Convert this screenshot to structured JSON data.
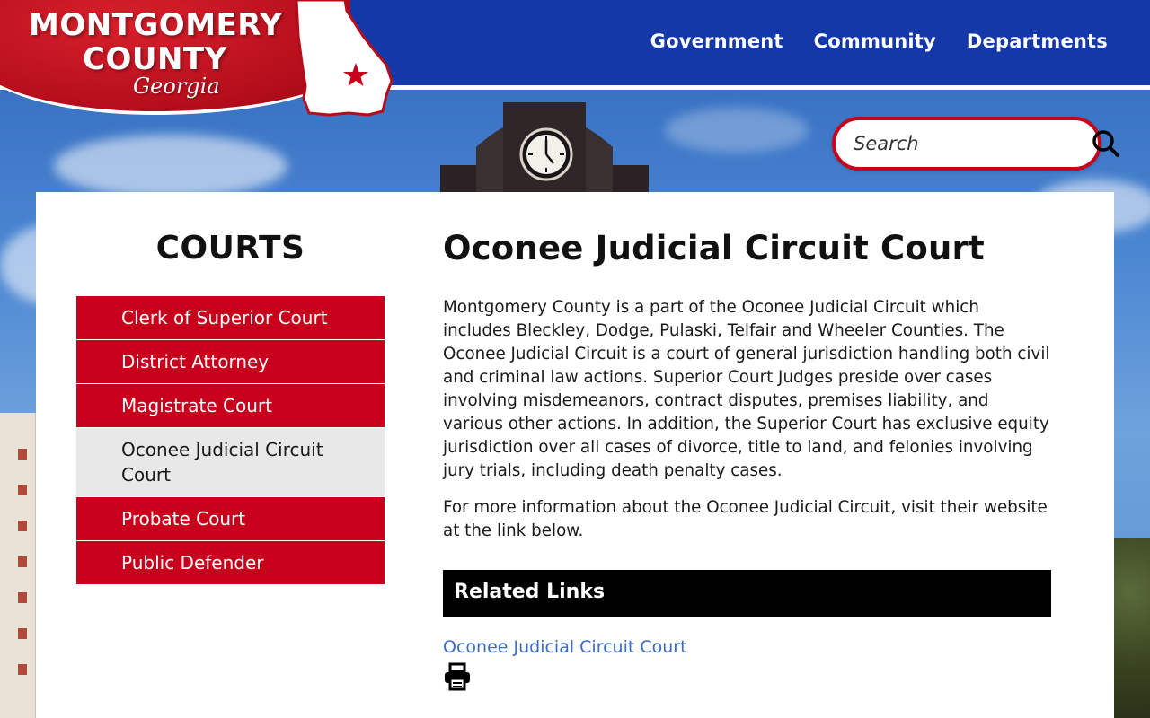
{
  "header": {
    "logo": {
      "line1": "MONTGOMERY",
      "line2": "COUNTY",
      "line3": "Georgia"
    },
    "nav": [
      {
        "label": "Government"
      },
      {
        "label": "Community"
      },
      {
        "label": "Departments"
      }
    ],
    "search": {
      "placeholder": "Search",
      "icon": "search-icon"
    }
  },
  "sidebar": {
    "title": "COURTS",
    "items": [
      {
        "label": "Clerk of Superior Court",
        "active": false
      },
      {
        "label": "District Attorney",
        "active": false
      },
      {
        "label": "Magistrate Court",
        "active": false
      },
      {
        "label": "Oconee Judicial Circuit Court",
        "active": true
      },
      {
        "label": "Probate Court",
        "active": false
      },
      {
        "label": "Public Defender",
        "active": false
      }
    ]
  },
  "main": {
    "title": "Oconee Judicial Circuit Court",
    "paragraph1": "Montgomery County is a part of the Oconee Judicial Circuit which includes Bleckley, Dodge, Pulaski, Telfair and Wheeler Counties. The Oconee Judicial Circuit is a court of general jurisdiction handling both civil and criminal law actions. Superior Court Judges preside over cases involving misdemeanors, contract disputes, premises liability, and various other actions. In addition, the Superior Court has exclusive equity jurisdiction over all cases of divorce, title to land, and felonies involving jury trials, including death penalty cases.",
    "paragraph2": "For more information about the Oconee Judicial Circuit, visit their website at the link below.",
    "related_heading": "Related Links",
    "related_links": [
      {
        "label": "Oconee Judicial Circuit Court"
      }
    ],
    "print_icon": "print-icon"
  },
  "colors": {
    "header_blue": "#1538a8",
    "accent_red": "#c8001c",
    "link_blue": "#3a6cc6",
    "active_item_bg": "#e8e8e8"
  }
}
